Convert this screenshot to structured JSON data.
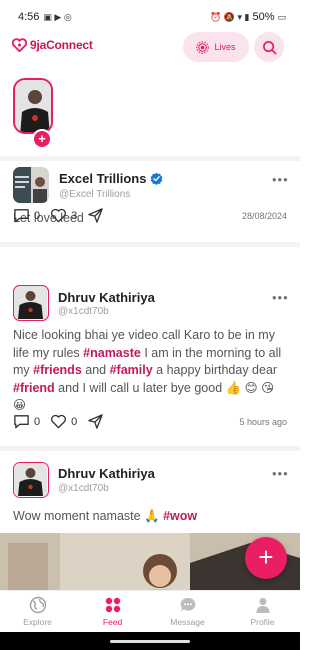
{
  "status_bar": {
    "time": "4:56",
    "battery": "50%"
  },
  "header": {
    "app_name": "9jaConnect",
    "lives_label": "Lives",
    "brand_color": "#e91e63"
  },
  "posts": [
    {
      "author": "Excel Trillions",
      "handle": "@Excel Trillions",
      "verified": true,
      "text": "Let love leed",
      "comments": "0",
      "likes": "3",
      "time": "28/08/2024"
    },
    {
      "author": "Dhruv Kathiriya",
      "handle": "@x1cdt70b",
      "text_parts": [
        "Nice looking bhai ye video call Karo to be in my life my rules ",
        "#namaste",
        " I am in the morning to all my ",
        "#friends",
        " and ",
        "#family",
        " a happy birthday dear ",
        "#friend",
        " and I will call u later bye good 👍 😊 😘 😀"
      ],
      "comments": "0",
      "likes": "0",
      "time": "5 hours ago"
    },
    {
      "author": "Dhruv Kathiriya",
      "handle": "@x1cdt70b",
      "text_parts": [
        "Wow moment namaste 🙏 ",
        "#wow"
      ]
    }
  ],
  "nav": [
    {
      "label": "Explore",
      "icon": "globe-icon",
      "active": false
    },
    {
      "label": "Feed",
      "icon": "grid-icon",
      "active": true
    },
    {
      "label": "Message",
      "icon": "chat-icon",
      "active": false
    },
    {
      "label": "Profile",
      "icon": "person-icon",
      "active": false
    }
  ]
}
